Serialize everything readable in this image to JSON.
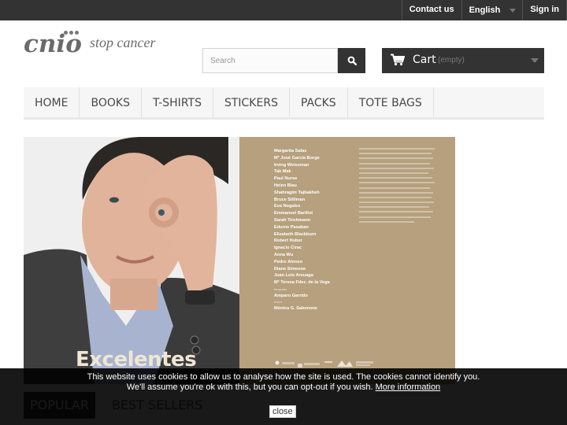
{
  "topbar": {
    "links": [
      {
        "label": "Contact us"
      },
      {
        "label": "English"
      },
      {
        "label": "Sign in"
      }
    ]
  },
  "logo": {
    "brand": "cnio",
    "tagline": "stop cancer"
  },
  "search": {
    "placeholder": "Search",
    "value": "",
    "button_icon": "search-icon"
  },
  "cart": {
    "label": "Cart",
    "status": "(empty)",
    "icon": "cart-icon"
  },
  "menu": {
    "items": [
      {
        "label": "HOME"
      },
      {
        "label": "BOOKS"
      },
      {
        "label": "T-SHIRTS"
      },
      {
        "label": "STICKERS"
      },
      {
        "label": "PACKS"
      },
      {
        "label": "TOTE BAGS"
      }
    ]
  },
  "slider": {
    "photo_title": "Excelentes",
    "names": [
      "Margarita Salas",
      "Mª José García Borge",
      "Irving Weissman",
      "Tak Mak",
      "Paul Nurse",
      "Helen Blau",
      "Shahragim Tajbakhsh",
      "Bruce Stillman",
      "Eva Nogales",
      "Emmanuel Barillot",
      "Sarah Teichmann",
      "Edurne Pasaban",
      "Elizabeth Blackburn",
      "Robert Huber",
      "Ignacio Cirac",
      "Anna Wu",
      "Pedro Alonso",
      "Diane Simeone",
      "Juan Luis Arsuaga",
      "Mª Teresa Fdez. de la Vega"
    ],
    "credits": [
      {
        "role": "fotografía",
        "name": "Amparo Garrido"
      },
      {
        "role": "textos",
        "name": "Mónica G. Salomone"
      }
    ],
    "prev_icon": "chevron-left-icon",
    "next_icon": "chevron-right-icon"
  },
  "tabs": [
    {
      "label": "POPULAR",
      "active": true
    },
    {
      "label": "BEST SELLERS",
      "active": false
    }
  ],
  "cookie": {
    "line1": "This website uses cookies to allow us to analyse how the site is used. The cookies cannot identify you.",
    "line2": "We'll assume you're ok with this, but you can opt-out if you wish.",
    "link": "More information",
    "close": "close"
  },
  "colors": {
    "topbar": "#333333",
    "cover": "#b6a07d",
    "menu_bg": "#f6f6f6"
  }
}
